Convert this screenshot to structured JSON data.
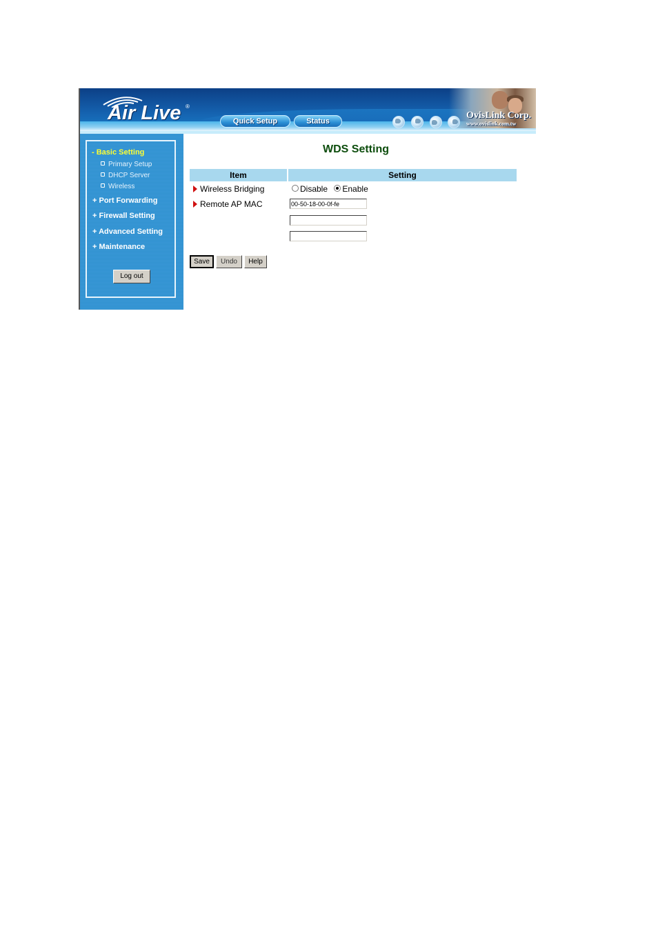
{
  "header": {
    "logo": "Air Live",
    "logo_mark": "®",
    "nav_buttons": [
      {
        "label": "Quick Setup"
      },
      {
        "label": "Status"
      }
    ],
    "globe_icons": [
      "globe-americas-icon",
      "globe-africa-icon",
      "globe-americas-icon",
      "globe-asia-icon"
    ],
    "corp_name": "OvisLink Corp.",
    "corp_url": "www.ovislink.com.tw"
  },
  "sidebar": {
    "menu": [
      {
        "label": "- Basic Setting",
        "active": true
      },
      {
        "label": "+ Port Forwarding"
      },
      {
        "label": "+ Firewall Setting"
      },
      {
        "label": "+ Advanced Setting"
      },
      {
        "label": "+ Maintenance"
      }
    ],
    "submenu": [
      {
        "label": "Primary Setup"
      },
      {
        "label": "DHCP Server"
      },
      {
        "label": "Wireless"
      }
    ],
    "logout_label": "Log out"
  },
  "main": {
    "title": "WDS Setting",
    "table_headers": {
      "item": "Item",
      "setting": "Setting"
    },
    "rows": [
      {
        "label": "Wireless Bridging"
      },
      {
        "label": "Remote AP MAC"
      }
    ],
    "wireless_bridging": {
      "options": [
        {
          "label": "Disable",
          "selected": false
        },
        {
          "label": "Enable",
          "selected": true
        }
      ]
    },
    "remote_ap_mac": [
      "00-50-18-00-0f-fe",
      "",
      ""
    ],
    "buttons": {
      "save": "Save",
      "undo": "Undo",
      "help": "Help"
    }
  },
  "colors": {
    "title_green": "#0d4d0d",
    "table_header_bg": "#a8d8ee",
    "active_menu": "#ffff33",
    "sidebar_bg": "#2f8fcf",
    "arrow_red": "#d01010"
  }
}
